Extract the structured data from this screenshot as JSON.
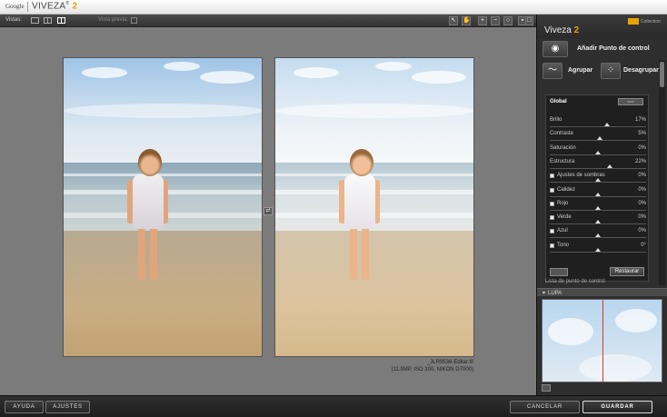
{
  "titlebar": {
    "brand": "Google",
    "app": "VIVEZA",
    "version": "2"
  },
  "toolbar": {
    "views_label": "Vistas:",
    "preview_label": "Vista previa:"
  },
  "canvas": {
    "file_name": "_JLR9536-Editar.tif",
    "file_meta": "(11.9MP, ISO 100, NIKON D7000)"
  },
  "panel": {
    "product": "Viveza",
    "product_num": "2",
    "collection": "Collection",
    "add_point": "Añadir Punto de control",
    "group": "Agrupar",
    "ungroup": "Desagrupar",
    "global_title": "Global",
    "restore": "Restaurar",
    "cp_list": "Lista de punto de control",
    "lupa": "LUPA",
    "sliders": [
      {
        "name": "Brillo",
        "value": "17%",
        "pos": 0.59,
        "check": false
      },
      {
        "name": "Contraste",
        "value": "5%",
        "pos": 0.52,
        "check": false
      },
      {
        "name": "Saturación",
        "value": "0%",
        "pos": 0.5,
        "check": false
      },
      {
        "name": "Estructura",
        "value": "22%",
        "pos": 0.62,
        "check": false
      },
      {
        "name": "Ajustes de sombras",
        "value": "0%",
        "pos": 0.5,
        "check": true
      },
      {
        "name": "Calidez",
        "value": "0%",
        "pos": 0.5,
        "check": true
      },
      {
        "name": "Rojo",
        "value": "0%",
        "pos": 0.5,
        "check": true
      },
      {
        "name": "Verde",
        "value": "0%",
        "pos": 0.5,
        "check": true
      },
      {
        "name": "Azul",
        "value": "0%",
        "pos": 0.5,
        "check": true
      },
      {
        "name": "Tono",
        "value": "0°",
        "pos": 0.5,
        "check": true
      }
    ]
  },
  "bottom": {
    "help": "AYUDA",
    "settings": "AJUSTES",
    "cancel": "CANCELAR",
    "save": "GUARDAR"
  }
}
